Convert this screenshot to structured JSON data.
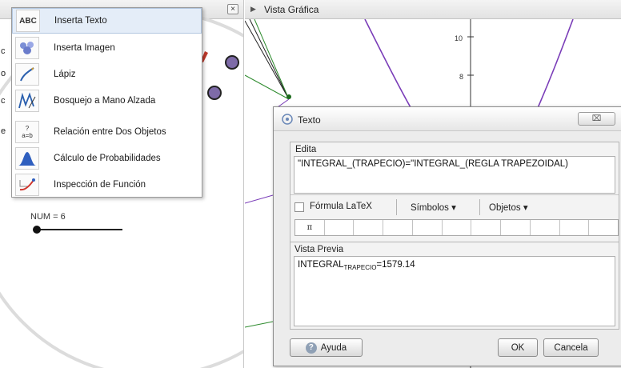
{
  "left_panel": {
    "close_glyph": "×",
    "slider_label": "NUM = 6"
  },
  "tool_menu": {
    "items": [
      {
        "label": "Inserta Texto",
        "icon": "abc-text-icon",
        "icon_text": "ABC"
      },
      {
        "label": "Inserta Imagen",
        "icon": "image-icon"
      },
      {
        "label": "Lápiz",
        "icon": "pen-icon"
      },
      {
        "label": "Bosquejo a Mano Alzada",
        "icon": "freehand-icon"
      },
      {
        "label": "Relación entre Dos Objetos",
        "icon": "relation-icon",
        "icon_text": "?\na=b"
      },
      {
        "label": "Cálculo de Probabilidades",
        "icon": "probability-icon"
      },
      {
        "label": "Inspección de Función",
        "icon": "function-inspect-icon"
      }
    ]
  },
  "graph": {
    "title": "Vista Gráfica",
    "y_ticks": [
      "10",
      "8"
    ]
  },
  "dialog": {
    "title": "Texto",
    "close_glyph": "⌧",
    "edita": {
      "label": "Edita",
      "value": "\"INTEGRAL_(TRAPECIO)=\"INTEGRAL_(REGLA TRAPEZOIDAL)",
      "latex_label": "Fórmula LaTeX",
      "symbols_label": "Símbolos ▾",
      "objects_label": "Objetos ▾",
      "symbol_row": [
        "π",
        "",
        "",
        "",
        "",
        "",
        "",
        "",
        "",
        "",
        ""
      ]
    },
    "preview": {
      "label": "Vista Previa",
      "main": "INTEGRAL",
      "subscript": "TRAPECIO",
      "result": "=1579.14"
    },
    "buttons": {
      "help": "Ayuda",
      "ok": "OK",
      "cancel": "Cancela"
    }
  },
  "colors": {
    "purple_curve": "#7a3db8",
    "green_line": "#2e8b2e",
    "point_purple": "#7e6ba8",
    "menu_highlight": "#e4edf8"
  }
}
